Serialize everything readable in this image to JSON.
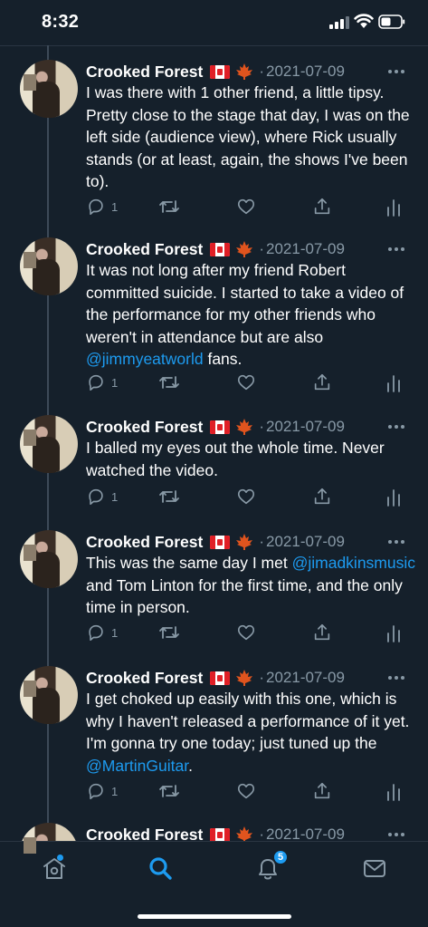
{
  "status_bar": {
    "time": "8:32"
  },
  "tweets": [
    {
      "author": "Crooked Forest",
      "separator": "·",
      "date": "2021-07-09",
      "text_parts": [
        {
          "t": "I was there with 1 other friend, a little tipsy. Pretty close to the stage that day, I was on the left side (audience view), where Rick usually stands (or at least, again, the shows I've been to).",
          "mention": false
        }
      ],
      "reply_count": "1"
    },
    {
      "author": "Crooked Forest",
      "separator": "·",
      "date": "2021-07-09",
      "text_parts": [
        {
          "t": "It was not long after my friend Robert committed suicide. I started to take a video of the performance for my other friends who weren't in attendance but are also ",
          "mention": false
        },
        {
          "t": "@jimmyeatworld",
          "mention": true
        },
        {
          "t": " fans.",
          "mention": false
        }
      ],
      "reply_count": "1"
    },
    {
      "author": "Crooked Forest",
      "separator": "·",
      "date": "2021-07-09",
      "text_parts": [
        {
          "t": "I balled my eyes out the whole time. Never watched the video.",
          "mention": false
        }
      ],
      "reply_count": "1"
    },
    {
      "author": "Crooked Forest",
      "separator": "·",
      "date": "2021-07-09",
      "text_parts": [
        {
          "t": "This was the same day I met ",
          "mention": false
        },
        {
          "t": "@jimadkinsmusic",
          "mention": true
        },
        {
          "t": " and Tom Linton for the first time, and the only time in person.",
          "mention": false
        }
      ],
      "reply_count": "1"
    },
    {
      "author": "Crooked Forest",
      "separator": "·",
      "date": "2021-07-09",
      "text_parts": [
        {
          "t": "I get choked up easily with this one, which is why I haven't released a performance of it yet. I'm gonna try one today; just tuned up the ",
          "mention": false
        },
        {
          "t": "@MartinGuitar",
          "mention": true
        },
        {
          "t": ".",
          "mention": false
        }
      ],
      "reply_count": "1"
    },
    {
      "author": "Crooked Forest",
      "separator": "·",
      "date": "2021-07-09",
      "text_parts": [],
      "reply_count": ""
    }
  ],
  "bottom_nav": {
    "items": [
      "home-icon",
      "search-icon",
      "notifications-icon",
      "messages-icon"
    ],
    "notification_badge": "5"
  },
  "colors": {
    "background": "#15202b",
    "accent": "#1d9bf0",
    "muted": "#8899a6",
    "divider": "#2a3542"
  }
}
